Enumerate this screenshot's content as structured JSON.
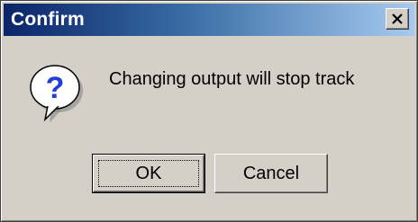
{
  "window": {
    "title": "Confirm",
    "close_glyph": "✕"
  },
  "dialog": {
    "icon": "question-icon",
    "icon_glyph": "?",
    "message": "Changing output will stop track"
  },
  "buttons": {
    "ok_label": "OK",
    "cancel_label": "Cancel"
  },
  "colors": {
    "title_gradient_start": "#0a246a",
    "title_gradient_end": "#a6caf0",
    "face": "#d4d0c8",
    "icon_question": "#1f3fd8"
  }
}
